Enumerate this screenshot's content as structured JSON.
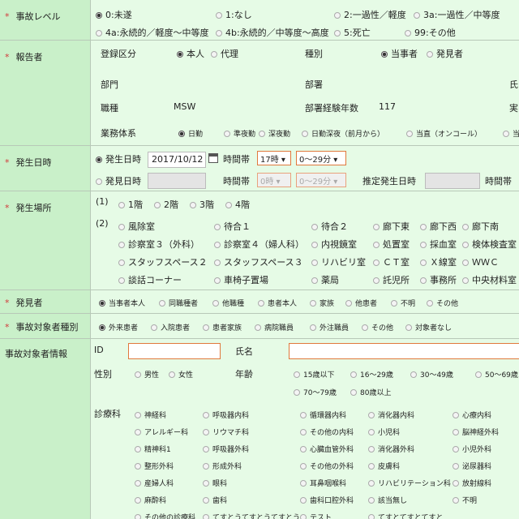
{
  "accident_level": {
    "label": "事故レベル",
    "options": [
      "0:未遂",
      "1:なし",
      "2:一過性／軽度",
      "3a:一過性／中等度",
      "4a:永続的／軽度～中等度",
      "4b:永続的／中等度～高度",
      "5:死亡",
      "99:その他"
    ],
    "selected": "0:未遂"
  },
  "reporter": {
    "label": "報告者",
    "reg_label": "登録区分",
    "reg_options": [
      "本人",
      "代理"
    ],
    "reg_selected": "本人",
    "type_label": "種別",
    "type_options": [
      "当事者",
      "発見者"
    ],
    "type_selected": "当事者",
    "dept_label": "部門",
    "section_label": "部署",
    "name_cut": "氏",
    "job_label": "職種",
    "job_value": "MSW",
    "years_label": "部署経験年数",
    "years_value": "117",
    "real_cut": "実",
    "shift_label": "業務体系",
    "shift_options": [
      "日勤",
      "準夜勤",
      "深夜勤",
      "日勤深夜（前月から）",
      "当直（オンコール）",
      "当"
    ],
    "shift_selected": "日勤"
  },
  "occurrence": {
    "label": "発生日時",
    "occ_label": "発生日時",
    "date": "2017/10/12",
    "time_label": "時間帯",
    "hour": "17時",
    "minute": "0～29分",
    "disc_label": "発見日時",
    "disc_hour": "0時",
    "disc_minute": "0～29分",
    "est_label": "推定発生日時",
    "time_label2": "時間帯"
  },
  "location": {
    "label": "発生場所",
    "n1": "(1)",
    "floors": [
      "1階",
      "2階",
      "3階",
      "4階"
    ],
    "n2": "(2)",
    "places": [
      [
        "風除室",
        "待合１",
        "待合２",
        "廊下東",
        "廊下西",
        "廊下南"
      ],
      [
        "診察室３（外科）",
        "診察室４（婦人科）",
        "内視鏡室",
        "処置室",
        "採血室",
        "検体検査室"
      ],
      [
        "スタッフスペース２",
        "スタッフスペース３",
        "リハビリ室",
        "ＣＴ室",
        "Ｘ線室",
        "ＷＷＣ"
      ],
      [
        "談話コーナー",
        "車椅子置場",
        "薬局",
        "託児所",
        "事務所",
        "中央材料室"
      ]
    ]
  },
  "discoverer": {
    "label": "発見者",
    "options": [
      "当事者本人",
      "同職種者",
      "他職種",
      "患者本人",
      "家族",
      "他患者",
      "不明",
      "その他"
    ],
    "selected": "当事者本人"
  },
  "target_type": {
    "label": "事故対象者種別",
    "options": [
      "外来患者",
      "入院患者",
      "患者家族",
      "病院職員",
      "外注職員",
      "その他",
      "対象者なし"
    ],
    "selected": "外来患者"
  },
  "target_info": {
    "label": "事故対象者情報",
    "id_label": "ID",
    "name_label": "氏名",
    "sex_label": "性別",
    "sex_options": [
      "男性",
      "女性"
    ],
    "age_label": "年齢",
    "age_options": [
      "15歳以下",
      "16～29歳",
      "30～49歳",
      "50～69歳",
      "70～79歳",
      "80歳以上"
    ],
    "dept_label": "診療科",
    "depts": [
      [
        "神経科",
        "呼吸器内科",
        "循環器内科",
        "消化器内科",
        "心療内科"
      ],
      [
        "アレルギー科",
        "リウマチ科",
        "その他の内科",
        "小児科",
        "脳神経外科"
      ],
      [
        "精神科1",
        "呼吸器外科",
        "心臓血管外科",
        "消化器外科",
        "小児外科"
      ],
      [
        "整形外科",
        "形成外科",
        "その他の外科",
        "皮膚科",
        "泌尿器科"
      ],
      [
        "産婦人科",
        "眼科",
        "耳鼻咽喉科",
        "リハビリテーション科",
        "放射線科"
      ],
      [
        "麻酔科",
        "歯科",
        "歯科口腔外科",
        "該当無し",
        "不明"
      ],
      [
        "その他の診療科",
        "てすとうてすとうてすとう",
        "テスト",
        "てすとてすとてすと",
        ""
      ]
    ]
  }
}
